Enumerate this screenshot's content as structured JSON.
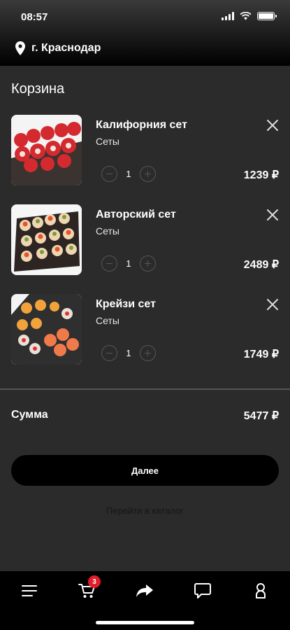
{
  "status_bar": {
    "time": "08:57"
  },
  "location": {
    "city": "г. Краснодар"
  },
  "cart": {
    "title": "Корзина",
    "items": [
      {
        "name": "Калифорния сет",
        "category": "Сеты",
        "quantity": "1",
        "price": "1239 ₽"
      },
      {
        "name": "Авторский сет",
        "category": "Сеты",
        "quantity": "1",
        "price": "2489 ₽"
      },
      {
        "name": "Крейзи сет",
        "category": "Сеты",
        "quantity": "1",
        "price": "1749 ₽"
      }
    ],
    "sum_label": "Сумма",
    "sum_value": "5477 ₽",
    "next_label": "Далее",
    "catalog_link": "Перейти в каталог"
  },
  "nav": {
    "cart_badge": "3",
    "icons": [
      "menu-icon",
      "cart-icon",
      "share-icon",
      "chat-icon",
      "profile-icon"
    ]
  },
  "colors": {
    "background": "#2b2b2b",
    "badge": "#e01e2b",
    "nav": "#000000"
  }
}
